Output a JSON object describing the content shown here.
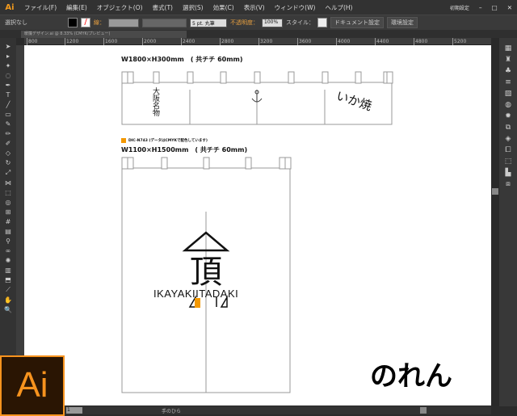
{
  "app": {
    "logo": "Ai",
    "workspace": "初期設定"
  },
  "menu": [
    "ファイル(F)",
    "編集(E)",
    "オブジェクト(O)",
    "書式(T)",
    "選択(S)",
    "効果(C)",
    "表示(V)",
    "ウィンドウ(W)",
    "ヘルプ(H)"
  ],
  "control": {
    "selection": "選択なし",
    "stroke_label": "線：",
    "brush": "5 pt. 丸筆",
    "opacity_label": "不透明度：",
    "opacity": "100%",
    "style_label": "スタイル：",
    "doc_settings": "ドキュメント設定",
    "prefs": "環境設定"
  },
  "tab": {
    "label": "暖簾デザイン.ai @ 8.33% (CMYK/プレビュー)"
  },
  "ruler": [
    "800",
    "1200",
    "1600",
    "2000",
    "2400",
    "2800",
    "3200",
    "3600",
    "4000",
    "4400",
    "4800",
    "5200"
  ],
  "artboard": {
    "banner_title": "W1800×H300mm　( 共チチ 60mm)",
    "banner_text_left": "大阪名物",
    "banner_text_right": "いか焼",
    "color_note": "DIC-N743 (データはCMYKで配色しています)",
    "color_swatch": "#f39800",
    "noren_title": "W1100×H1500mm　( 共チチ 60mm)",
    "logo_text": "IKAYAKIITADAKI",
    "logo_kanji": "頂",
    "caption": "のれん"
  },
  "status": {
    "page": "1",
    "tool": "手のひら"
  }
}
